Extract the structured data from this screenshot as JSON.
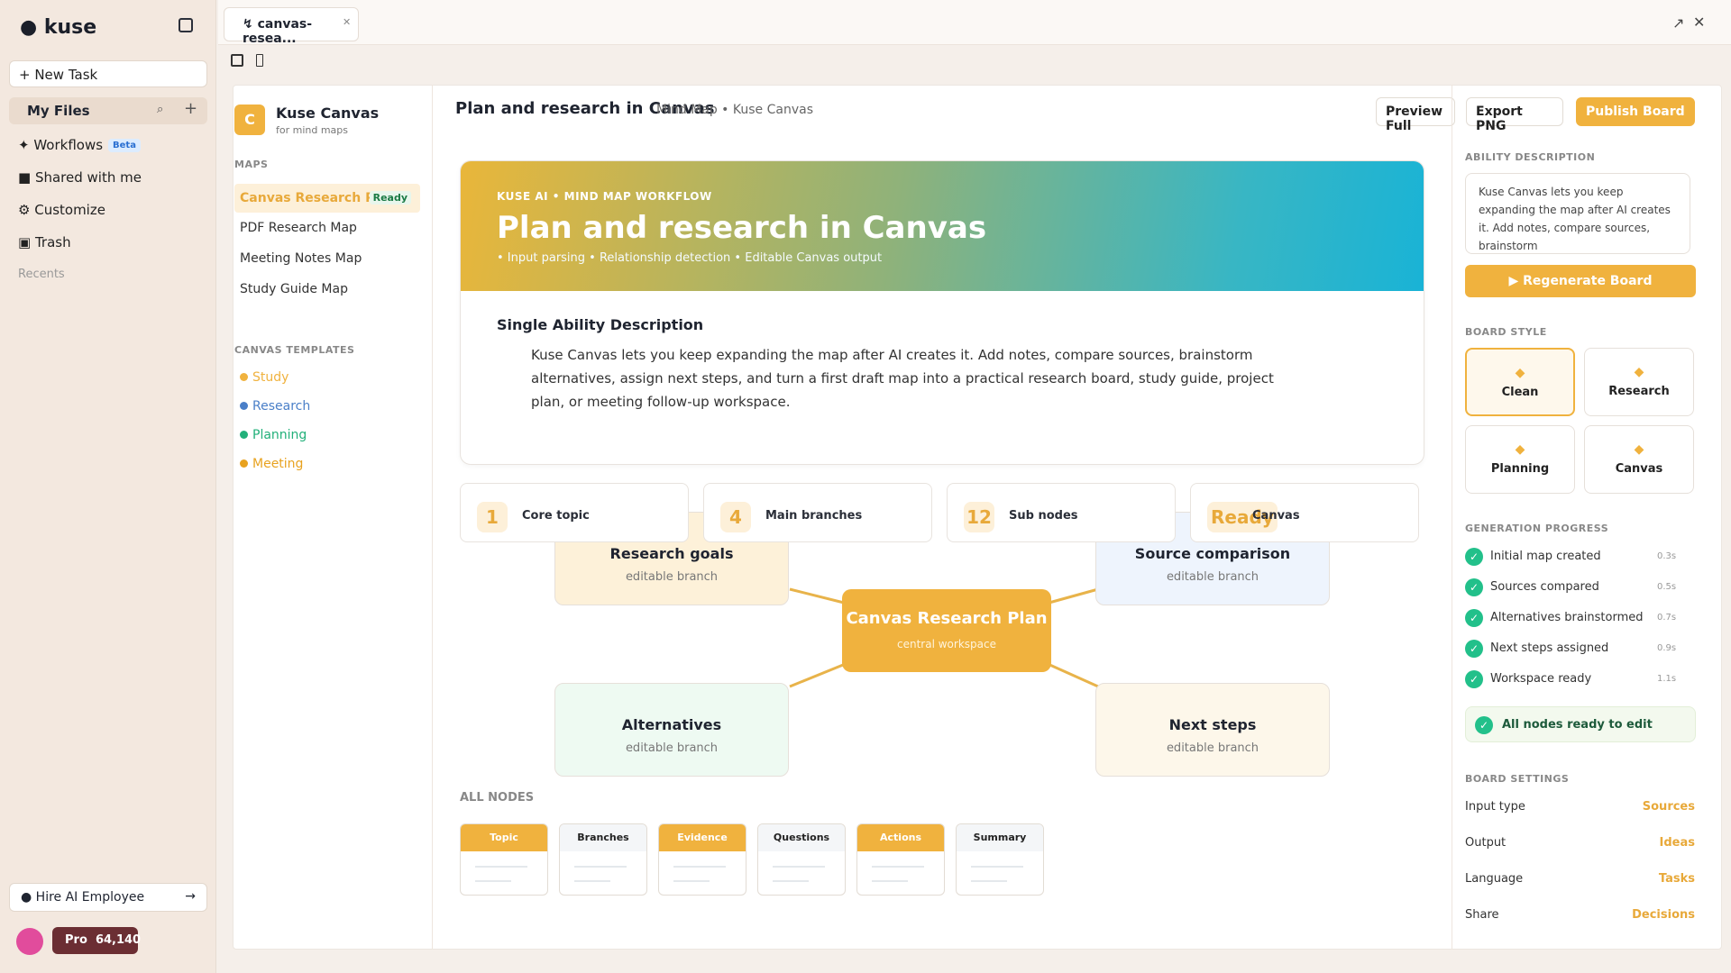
{
  "app": {
    "name": "kuse",
    "new_task": "+ New Task",
    "my_files": "My Files",
    "nav": [
      {
        "label": "✦ Workflows",
        "badge": "Beta"
      },
      {
        "label": "■ Shared with me"
      },
      {
        "label": "⚙ Customize"
      },
      {
        "label": "▣ Trash"
      }
    ],
    "recents": "Recents",
    "hire": "● Hire AI Employee",
    "hire_arrow": "→",
    "pro_label": "Pro",
    "credits": "64,140"
  },
  "tab": {
    "title": "↯ canvas-resea..."
  },
  "workspace": {
    "name": "Kuse Canvas",
    "badge": "C",
    "subtitle": "for mind maps",
    "maps_heading": "MAPS",
    "maps": [
      {
        "label": "Canvas Research Pla",
        "status": "Ready"
      },
      {
        "label": "PDF Research Map"
      },
      {
        "label": "Meeting Notes Map"
      },
      {
        "label": "Study Guide Map"
      }
    ],
    "templates_heading": "CANVAS TEMPLATES",
    "templates": [
      {
        "label": "Study",
        "color": "#f0b23e"
      },
      {
        "label": "Research",
        "color": "#4a7fc8"
      },
      {
        "label": "Planning",
        "color": "#22b07a"
      },
      {
        "label": "Meeting",
        "color": "#e8a21f"
      }
    ]
  },
  "header": {
    "title": "Plan and research in Canvas",
    "crumb": "Mind Map • Kuse Canvas",
    "preview": "Preview Full",
    "export": "Export PNG",
    "publish": "Publish Board"
  },
  "hero": {
    "eyebrow": "KUSE AI • MIND MAP WORKFLOW",
    "title": "Plan and research in Canvas",
    "features": "• Input parsing • Relationship detection • Editable Canvas output",
    "ability_title": "Single Ability Description",
    "ability_text": "Kuse Canvas lets you keep expanding the map after AI creates it. Add notes, compare sources, brainstorm alternatives, assign next steps, and turn a first draft map into a practical research board, study guide, project plan, or meeting follow-up workspace."
  },
  "stats": [
    {
      "num": "1",
      "label": "Core topic"
    },
    {
      "num": "4",
      "label": "Main branches"
    },
    {
      "num": "12",
      "label": "Sub nodes"
    },
    {
      "num": "Ready",
      "label": "Canvas"
    }
  ],
  "mindmap": {
    "center": {
      "title": "Canvas Research Plan",
      "sub": "central workspace"
    },
    "branches": [
      {
        "title": "Research goals",
        "sub": "editable branch",
        "bg": "#fdf1d9"
      },
      {
        "title": "Source comparison",
        "sub": "editable branch",
        "bg": "#eef4fd"
      },
      {
        "title": "Alternatives",
        "sub": "editable branch",
        "bg": "#eefaf2"
      },
      {
        "title": "Next steps",
        "sub": "editable branch",
        "bg": "#fdf7ea"
      }
    ],
    "link_color": "#e8b34a"
  },
  "all_nodes": {
    "heading": "ALL NODES",
    "chips": [
      {
        "label": "Topic",
        "highlight": true
      },
      {
        "label": "Branches",
        "highlight": false
      },
      {
        "label": "Evidence",
        "highlight": true
      },
      {
        "label": "Questions",
        "highlight": false
      },
      {
        "label": "Actions",
        "highlight": true
      },
      {
        "label": "Summary",
        "highlight": false
      }
    ]
  },
  "right": {
    "ability_heading": "ABILITY DESCRIPTION",
    "ability_text": "Kuse Canvas lets you keep expanding the map after AI creates it. Add notes, compare sources, brainstorm",
    "regenerate": "▶ Regenerate Board",
    "style_heading": "BOARD STYLE",
    "styles": [
      {
        "label": "Clean",
        "selected": true
      },
      {
        "label": "Research",
        "selected": false
      },
      {
        "label": "Planning",
        "selected": false
      },
      {
        "label": "Canvas",
        "selected": false
      }
    ],
    "progress_heading": "GENERATION PROGRESS",
    "progress": [
      {
        "label": "Initial map created",
        "time": "0.3s"
      },
      {
        "label": "Sources compared",
        "time": "0.5s"
      },
      {
        "label": "Alternatives brainstormed",
        "time": "0.7s"
      },
      {
        "label": "Next steps assigned",
        "time": "0.9s"
      },
      {
        "label": "Workspace ready",
        "time": "1.1s"
      }
    ],
    "all_ready": "All nodes ready to edit",
    "settings_heading": "BOARD SETTINGS",
    "settings": [
      {
        "key": "Input type",
        "value": "Sources"
      },
      {
        "key": "Output",
        "value": "Ideas"
      },
      {
        "key": "Language",
        "value": "Tasks"
      },
      {
        "key": "Share",
        "value": "Decisions"
      }
    ]
  }
}
